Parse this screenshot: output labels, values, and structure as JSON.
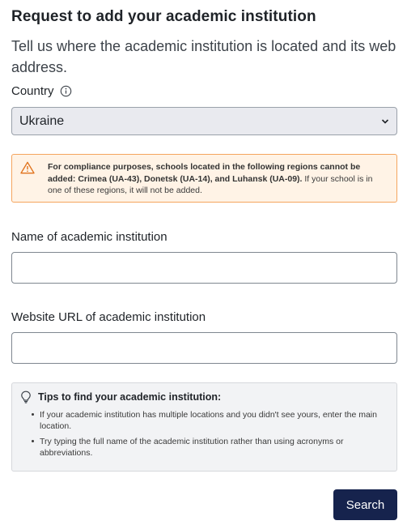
{
  "form": {
    "title": "Request to add your academic institution",
    "subtitle": "Tell us where the academic institution is located and its web address.",
    "country_label": "Country",
    "country_value": "Ukraine",
    "alert": {
      "bold_text": "For compliance purposes, schools located in the following regions cannot be added: Crimea (UA-43), Donetsk (UA-14), and Luhansk (UA-09).",
      "normal_text": " If your school is in one of these regions, it will not be added."
    },
    "name_label": "Name of academic institution",
    "name_value": "",
    "url_label": "Website URL of academic institution",
    "url_value": "",
    "tips": {
      "heading": "Tips to find your academic institution:",
      "items": [
        "If your academic institution has multiple locations and you didn't see yours, enter the main location.",
        "Try typing the full name of the academic institution rather than using acronyms or abbreviations."
      ]
    },
    "search_label": "Search"
  },
  "icons": {
    "info": "info-icon",
    "chevron": "chevron-down-icon",
    "warning": "warning-icon",
    "bulb": "lightbulb-icon"
  },
  "colors": {
    "button": "#16234d",
    "alert_border": "#f5a55e",
    "alert_bg": "#fff3e6"
  }
}
